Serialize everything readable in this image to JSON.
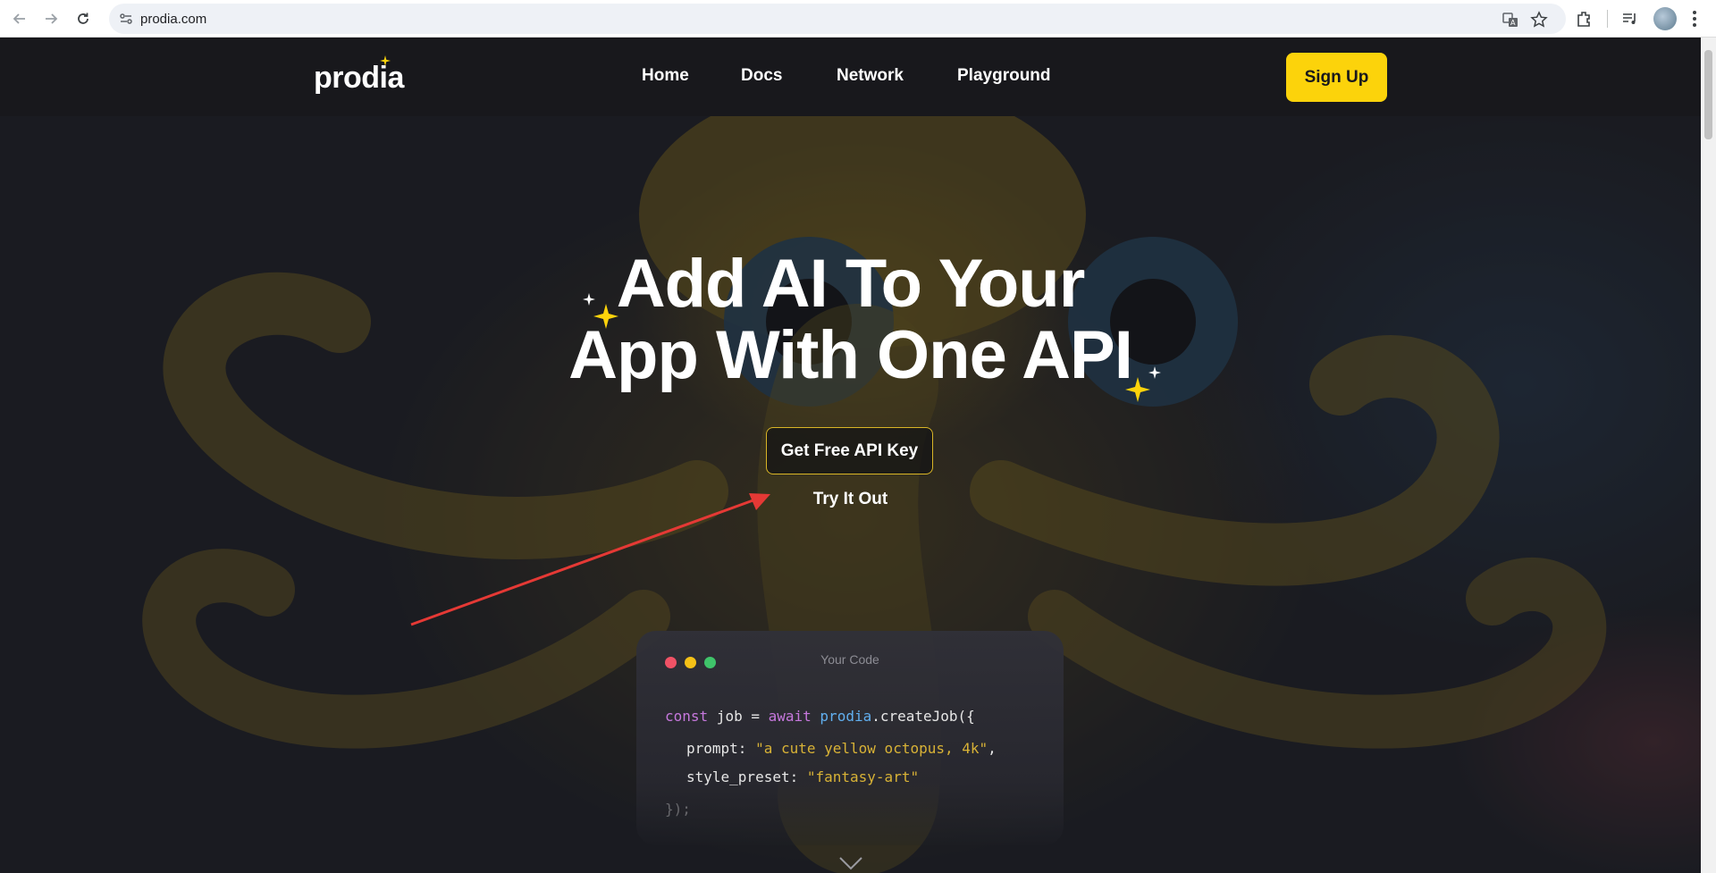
{
  "browser": {
    "url": "prodia.com"
  },
  "header": {
    "logo": "prodia",
    "nav": [
      "Home",
      "Docs",
      "Network",
      "Playground"
    ],
    "signup": "Sign Up"
  },
  "hero": {
    "title_line1": "Add AI To Your",
    "title_line2": "App With One API",
    "cta": "Get Free API Key",
    "secondary": "Try It Out"
  },
  "code": {
    "title": "Your Code",
    "line1": {
      "kw1": "const",
      "var": " job = ",
      "kw2": "await",
      "sp": " ",
      "obj": "prodia",
      "rest": ".createJob({"
    },
    "line2": {
      "key": "prompt: ",
      "val": "\"a cute yellow octopus, 4k\"",
      "end": ","
    },
    "line3": {
      "key": "style_preset: ",
      "val": "\"fantasy-art\""
    },
    "line4": "});"
  },
  "colors": {
    "accent": "#fcd30b",
    "header_bg": "#18181c",
    "annotation_arrow": "#e53935"
  }
}
